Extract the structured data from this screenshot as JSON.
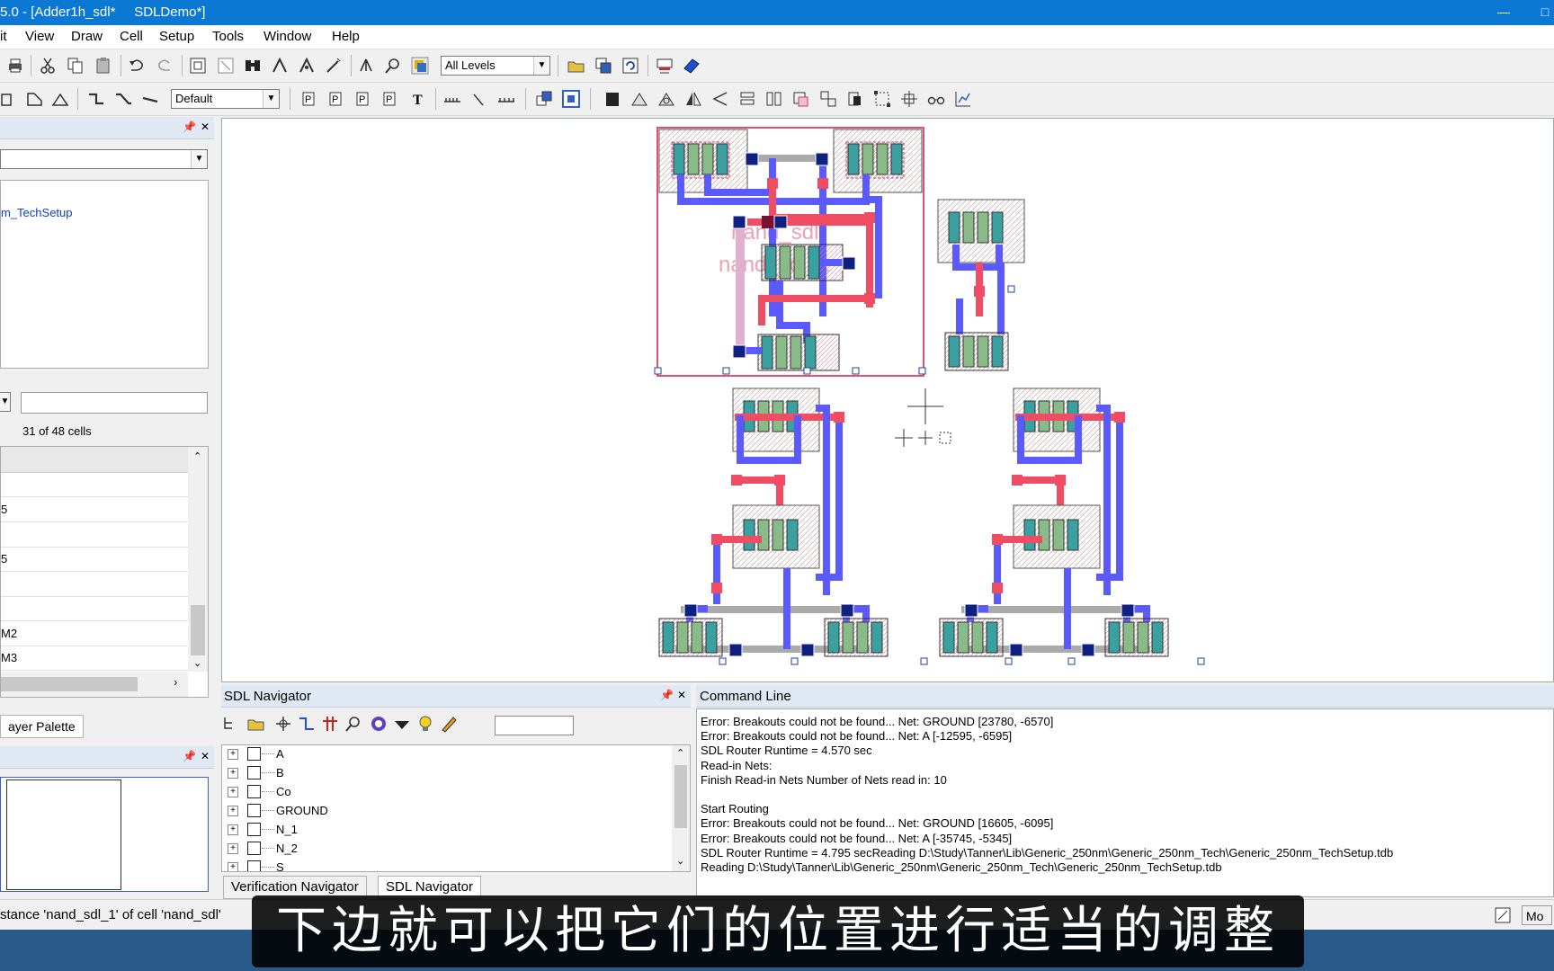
{
  "window": {
    "title": "5.0 - [Adder1h_sdl*     SDLDemo*]"
  },
  "menu": [
    "it",
    "View",
    "Draw",
    "Cell",
    "Setup",
    "Tools",
    "Window",
    "Help"
  ],
  "toolbar1": {
    "levels_value": "All Levels"
  },
  "toolbar2": {
    "style_value": "Default"
  },
  "left_panel": {
    "tech_setup_label": "m_TechSetup",
    "cells_count": "31 of 48 cells",
    "rows": [
      "",
      "5",
      "",
      "5",
      "",
      "",
      "M2",
      "M3"
    ],
    "layer_palette_tab": "ayer Palette"
  },
  "sdl_navigator": {
    "title": "SDL Navigator",
    "nets": [
      "A",
      "B",
      "Co",
      "GROUND",
      "N_1",
      "N_2",
      "S"
    ]
  },
  "bottom_tabs": {
    "verification": "Verification Navigator",
    "sdl": "SDL Navigator"
  },
  "command_line": {
    "title": "Command Line",
    "lines": [
      "Error: Breakouts could not be found... Net: GROUND [23780, -6570]",
      "Error: Breakouts could not be found... Net: A [-12595, -6595]",
      "SDL Router Runtime = 4.570 sec",
      "Read-in Nets:",
      "Finish Read-in Nets Number of Nets read in: 10",
      "",
      "Start Routing",
      "Error: Breakouts could not be found... Net: GROUND [16605, -6095]",
      "Error: Breakouts could not be found... Net: A [-35745, -5345]",
      "SDL Router Runtime = 4.795 secReading D:\\Study\\Tanner\\Lib\\Generic_250nm\\Generic_250nm_Tech\\Generic_250nm_TechSetup.tdb",
      "Reading D:\\Study\\Tanner\\Lib\\Generic_250nm\\Generic_250nm_Tech\\Generic_250nm_TechSetup.tdb"
    ]
  },
  "canvas": {
    "cell_label_1": "nand_sdl",
    "cell_label_2": "nand_sdl_1"
  },
  "status_bar": {
    "text": "stance 'nand_sdl_1' of cell 'nand_sdl'",
    "right_text": "Mo"
  },
  "subtitle": "下边就可以把它们的位置进行适当的调整",
  "colors": {
    "titlebar": "#0b78d4",
    "metal1": "#5a5aff",
    "poly": "#f04c64",
    "select": "#e05070"
  }
}
